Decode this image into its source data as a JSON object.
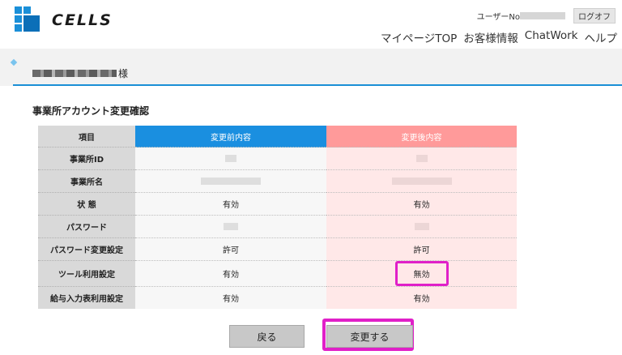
{
  "header": {
    "brand": "CELLS",
    "user_label": "ユーザーNo",
    "logout": "ログオフ",
    "nav": [
      "マイページTOP",
      "お客様情報",
      "ChatWork",
      "ヘルプ"
    ]
  },
  "account": {
    "honorific": "様"
  },
  "page": {
    "title": "事業所アカウント変更確認"
  },
  "table": {
    "headers": {
      "item": "項目",
      "before": "変更前内容",
      "after": "変更後内容"
    },
    "rows": [
      {
        "label": "事業所ID",
        "before": "",
        "after": ""
      },
      {
        "label": "事業所名",
        "before": "",
        "after": ""
      },
      {
        "label": "状 態",
        "before": "有効",
        "after": "有効"
      },
      {
        "label": "パスワード",
        "before": "",
        "after": ""
      },
      {
        "label": "パスワード変更設定",
        "before": "許可",
        "after": "許可"
      },
      {
        "label": "ツール利用設定",
        "before": "有効",
        "after": "無効"
      },
      {
        "label": "給与入力表利用設定",
        "before": "有効",
        "after": "有効"
      }
    ]
  },
  "buttons": {
    "back": "戻る",
    "change": "変更する"
  },
  "colors": {
    "accent": "#1a8fe0",
    "after_header": "#ff9a9a",
    "highlight": "#e020c8"
  }
}
